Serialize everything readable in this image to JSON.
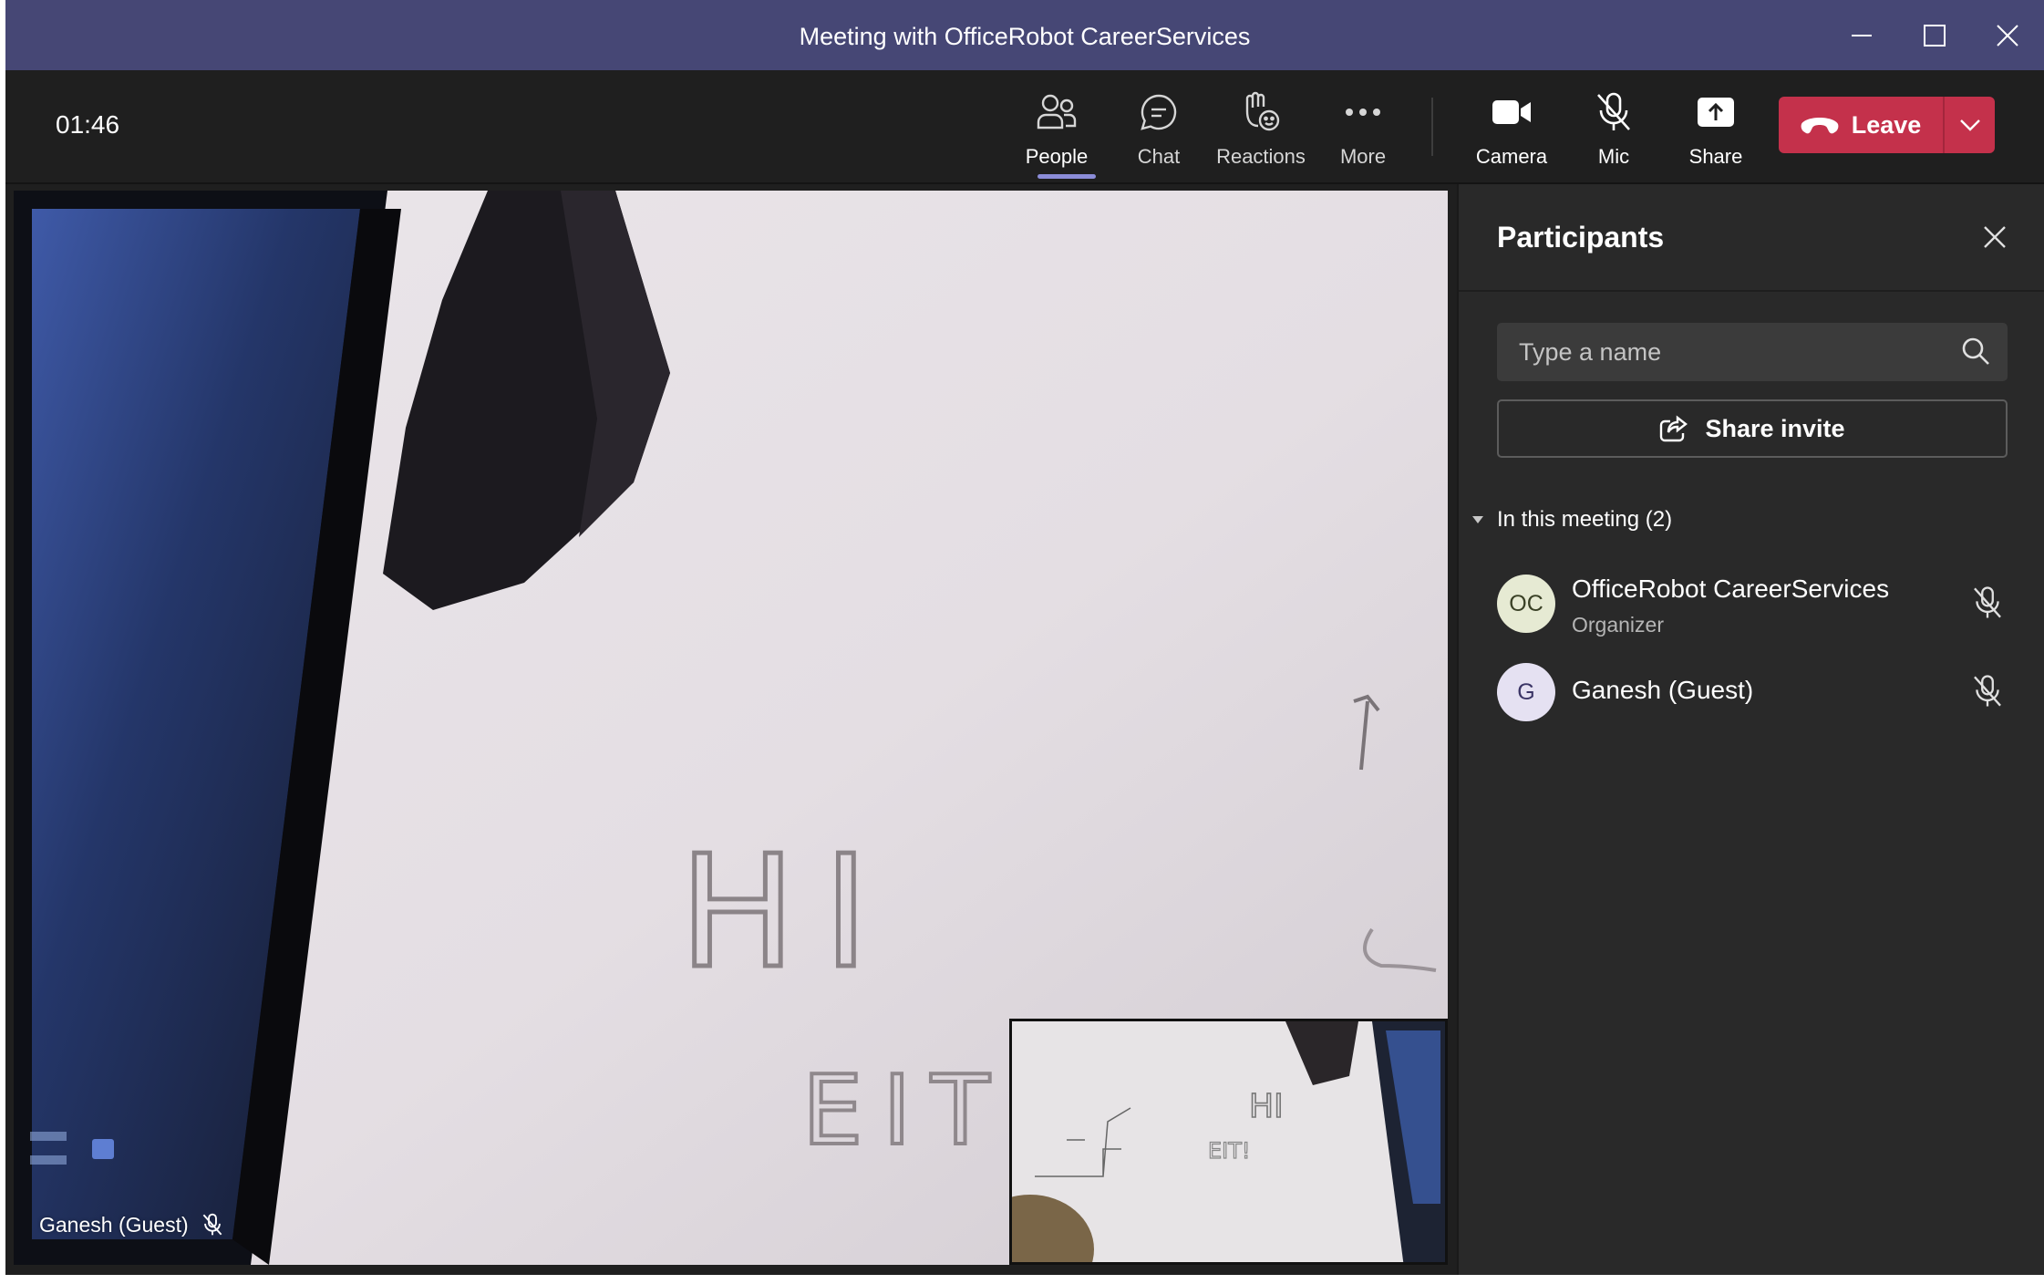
{
  "window": {
    "title": "Meeting with OfficeRobot CareerServices"
  },
  "toolbar": {
    "timer": "01:46",
    "people_label": "People",
    "chat_label": "Chat",
    "reactions_label": "Reactions",
    "more_label": "More",
    "camera_label": "Camera",
    "mic_label": "Mic",
    "share_label": "Share",
    "leave_label": "Leave"
  },
  "stage": {
    "speaker_name": "Ganesh (Guest)",
    "whiteboard_line1": "HI",
    "whiteboard_line2": "EIT!"
  },
  "participants_panel": {
    "title": "Participants",
    "search_placeholder": "Type a name",
    "share_invite_label": "Share invite",
    "section_label": "In this meeting (2)",
    "participants": [
      {
        "initials": "OC",
        "name": "OfficeRobot CareerServices",
        "role": "Organizer",
        "avatar_bg": "#e6ead3",
        "avatar_fg": "#3a4126",
        "muted": true
      },
      {
        "initials": "G",
        "name": "Ganesh (Guest)",
        "role": "",
        "avatar_bg": "#e5e1f2",
        "avatar_fg": "#3b3566",
        "muted": true
      }
    ]
  },
  "colors": {
    "title_bar": "#464775",
    "accent": "#8b8cd8",
    "leave": "#c4314b",
    "app_bg": "#1f1f1f",
    "panel_bg": "#292929"
  },
  "icons": [
    "minimize-icon",
    "maximize-icon",
    "close-icon",
    "people-icon",
    "chat-icon",
    "reactions-icon",
    "more-icon",
    "camera-icon",
    "mic-off-icon",
    "share-icon",
    "phone-hangup-icon",
    "chevron-down-icon",
    "search-icon",
    "share-invite-icon",
    "caret-down-icon"
  ]
}
